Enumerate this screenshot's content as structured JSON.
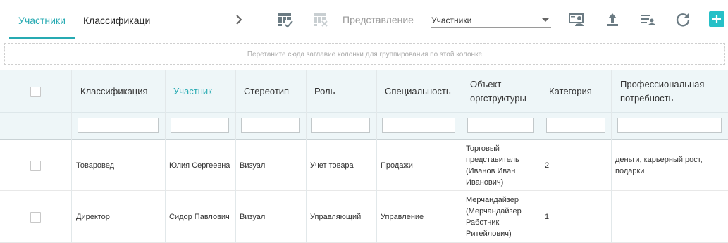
{
  "tabs": [
    {
      "label": "Участники",
      "active": true
    },
    {
      "label": "Классификаци",
      "active": false
    }
  ],
  "toolbar": {
    "view_label": "Представление",
    "view_value": "Участники",
    "icons": [
      "chevron-right-icon",
      "table-check-icon",
      "table-remove-icon",
      "user-card-icon",
      "upload-icon",
      "filter-list-icon",
      "refresh-icon",
      "plus-icon"
    ]
  },
  "group_zone_text": "Перетаните сюда заглавие колонки для группирования по этой колонке",
  "columns": [
    {
      "label": "Классификация"
    },
    {
      "label": "Участник",
      "active": true
    },
    {
      "label": "Стереотип"
    },
    {
      "label": "Роль"
    },
    {
      "label": "Специальность"
    },
    {
      "label": "Объект оргструктуры"
    },
    {
      "label": "Категория"
    },
    {
      "label": "Профессиональная потребность"
    }
  ],
  "rows": [
    {
      "cells": [
        "Товаровед",
        "Юлия Сергеевна",
        "Визуал",
        "Учет товара",
        "Продажи",
        "Торговый представитель (Иванов Иван Иванович)",
        "2",
        "деньги, карьерный рост, подарки"
      ]
    },
    {
      "cells": [
        "Директор",
        "Сидор Павлович",
        "Визуал",
        "Управляющий",
        "Управление",
        "Мерчандайзер (Мерчандайзер Работник Ритейлович)",
        "1",
        ""
      ]
    }
  ],
  "colors": {
    "accent": "#26aab2",
    "header_bg": "#eef6f8",
    "add_button": "#26c0c7"
  }
}
